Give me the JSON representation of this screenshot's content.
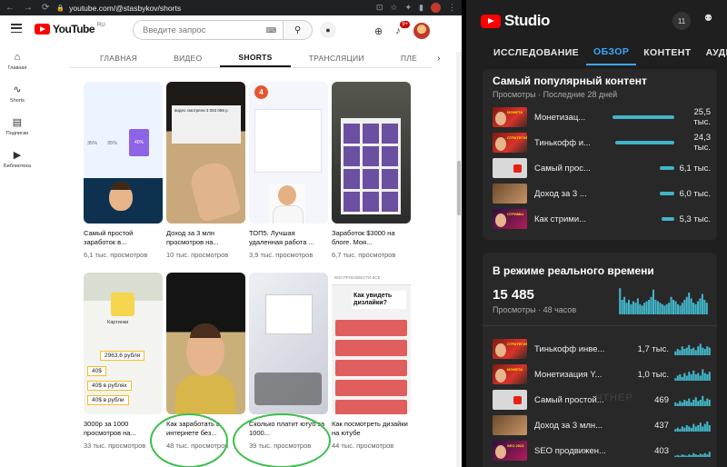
{
  "browser": {
    "url": "youtube.com/@stasbykov/shorts",
    "nav": [
      "←",
      "→",
      "⟳"
    ],
    "ext_icons": [
      "⊡",
      "☆",
      "✦",
      "▮"
    ]
  },
  "youtube": {
    "logo_text": "YouTube",
    "logo_region": "RU",
    "search_placeholder": "Введите запрос",
    "kbd_icon": "⌨",
    "search_icon": "⚲",
    "mic_icon": "🎙",
    "notif_count": "9+",
    "sidebar": [
      {
        "icon": "⌂",
        "label": "Главная"
      },
      {
        "icon": "∿",
        "label": "Shorts"
      },
      {
        "icon": "▤",
        "label": "Подписки"
      },
      {
        "icon": "▶",
        "label": "Библиотека"
      }
    ],
    "tabs": [
      {
        "label": "ГЛАВНАЯ",
        "active": false
      },
      {
        "label": "ВИДЕО",
        "active": false
      },
      {
        "label": "SHORTS",
        "active": true
      },
      {
        "label": "ТРАНСЛЯЦИИ",
        "active": false
      },
      {
        "label": "ПЛЕ",
        "active": false
      }
    ],
    "tabs_arrow": "›",
    "shorts": [
      {
        "title": "Самый простой заработок в...",
        "views": "6,1 тыс. просмотров"
      },
      {
        "title": "Доход за 3 млн просмотров на...",
        "views": "10 тыс. просмотров"
      },
      {
        "title": "ТОП5. Лучшая удаленная работа ...",
        "views": "3,9 тыс. просмотров"
      },
      {
        "title": "Заработок $3000 на блоге. Моя...",
        "views": "6,7 тыс. просмотров"
      },
      {
        "title": "3000р за 1000 просмотров на...",
        "views": "33 тыс. просмотров"
      },
      {
        "title": "Как заработать в интернете без...",
        "views": "48 тыс. просмотров"
      },
      {
        "title": "Сколько платит ютуб за 1000...",
        "views": "39 тыс. просмотров"
      },
      {
        "title": "Как посмотреть дизайки на ютубе",
        "views": "44 тыс. просмотров"
      }
    ],
    "thumb_text": {
      "t1_pct_a": "35%",
      "t1_pct_b": "40%",
      "t1_pct_c": "35%",
      "t2_text": "видео смотрели 3 093 058 р",
      "t3_num": "4",
      "t5_chip_a": "2963,6 рубля",
      "t5_chip_b": "40$",
      "t5_chip_c": "40$ в рублях",
      "t5_chip_d": "40$ в рубли",
      "t8_header": "ВОСПРОИЗВЕСТИ ВСЕ",
      "t8_text": "Как увидеть дизлайки?"
    }
  },
  "studio": {
    "logo_text": "Studio",
    "notif": "11",
    "tabs": [
      {
        "label": "ИССЛЕДОВАНИЕ",
        "active": false
      },
      {
        "label": "ОБЗОР",
        "active": true
      },
      {
        "label": "КОНТЕНТ",
        "active": false
      },
      {
        "label": "АУДИТОР",
        "active": false
      }
    ],
    "popular": {
      "title": "Самый популярный контент",
      "subtitle": "Просмотры · Последние 28 дней",
      "rows": [
        {
          "title": "Монетизац...",
          "value": "25,5 тыс.",
          "fraction": 1.0,
          "thumb": "red",
          "tag": "МОНЕТА"
        },
        {
          "title": "Тинькофф и...",
          "value": "24,3 тыс.",
          "fraction": 0.95,
          "thumb": "red",
          "tag": "СТРАТЕГИЯ"
        },
        {
          "title": "Самый прос...",
          "value": "6,1 тыс.",
          "fraction": 0.24,
          "thumb": "grey",
          "tag": ""
        },
        {
          "title": "Доход за 3 ...",
          "value": "6,0 тыс.",
          "fraction": 0.23,
          "thumb": "brown",
          "tag": ""
        },
        {
          "title": "Как стрими...",
          "value": "5,3 тыс.",
          "fraction": 0.21,
          "thumb": "dark",
          "tag": "СТРИМЫ"
        }
      ]
    },
    "realtime": {
      "title": "В режиме реального времени",
      "count": "15 485",
      "subtitle": "Просмотры · 48 часов",
      "spark": [
        0.9,
        0.5,
        0.6,
        0.4,
        0.5,
        0.35,
        0.45,
        0.4,
        0.55,
        0.35,
        0.3,
        0.4,
        0.45,
        0.5,
        0.6,
        0.85,
        0.5,
        0.45,
        0.4,
        0.35,
        0.3,
        0.35,
        0.4,
        0.6,
        0.5,
        0.45,
        0.35,
        0.3,
        0.4,
        0.5,
        0.6,
        0.75,
        0.55,
        0.4,
        0.35,
        0.45,
        0.55,
        0.7,
        0.5,
        0.4
      ],
      "rows": [
        {
          "title": "Тинькофф инве...",
          "value": "1,7 тыс.",
          "thumb": "red",
          "tag": "СТРАТЕГИЯ",
          "spark": [
            0.3,
            0.5,
            0.4,
            0.7,
            0.5,
            0.6,
            0.8,
            0.5,
            0.6,
            0.4,
            0.7,
            0.9,
            0.6,
            0.5,
            0.7,
            0.6
          ]
        },
        {
          "title": "Монетизация Y...",
          "value": "1,0 тыс.",
          "thumb": "red",
          "tag": "МОНЕТА",
          "spark": [
            0.2,
            0.4,
            0.5,
            0.3,
            0.6,
            0.4,
            0.7,
            0.5,
            0.8,
            0.5,
            0.6,
            0.4,
            0.9,
            0.6,
            0.5,
            0.7
          ]
        },
        {
          "title": "Самый простой...",
          "value": "469",
          "thumb": "grey",
          "tag": "",
          "spark": [
            0.3,
            0.2,
            0.4,
            0.3,
            0.5,
            0.4,
            0.6,
            0.3,
            0.5,
            0.7,
            0.4,
            0.5,
            0.8,
            0.4,
            0.6,
            0.5
          ]
        },
        {
          "title": "Доход за 3 млн...",
          "value": "437",
          "thumb": "brown",
          "tag": "",
          "spark": [
            0.2,
            0.3,
            0.2,
            0.4,
            0.3,
            0.5,
            0.4,
            0.3,
            0.6,
            0.4,
            0.5,
            0.7,
            0.4,
            0.6,
            0.8,
            0.5
          ]
        },
        {
          "title": "SEO продвижен...",
          "value": "403",
          "thumb": "dark",
          "tag": "SEO 2023",
          "spark": [
            0.1,
            0.15,
            0.1,
            0.2,
            0.15,
            0.1,
            0.2,
            0.15,
            0.3,
            0.2,
            0.15,
            0.25,
            0.2,
            0.3,
            0.2,
            0.4
          ]
        }
      ]
    },
    "colors": {
      "accent": "#3ea6ff",
      "bar": "#42b4c8",
      "yt_red": "#ff0000",
      "annotation": "#3bbf4a"
    }
  }
}
